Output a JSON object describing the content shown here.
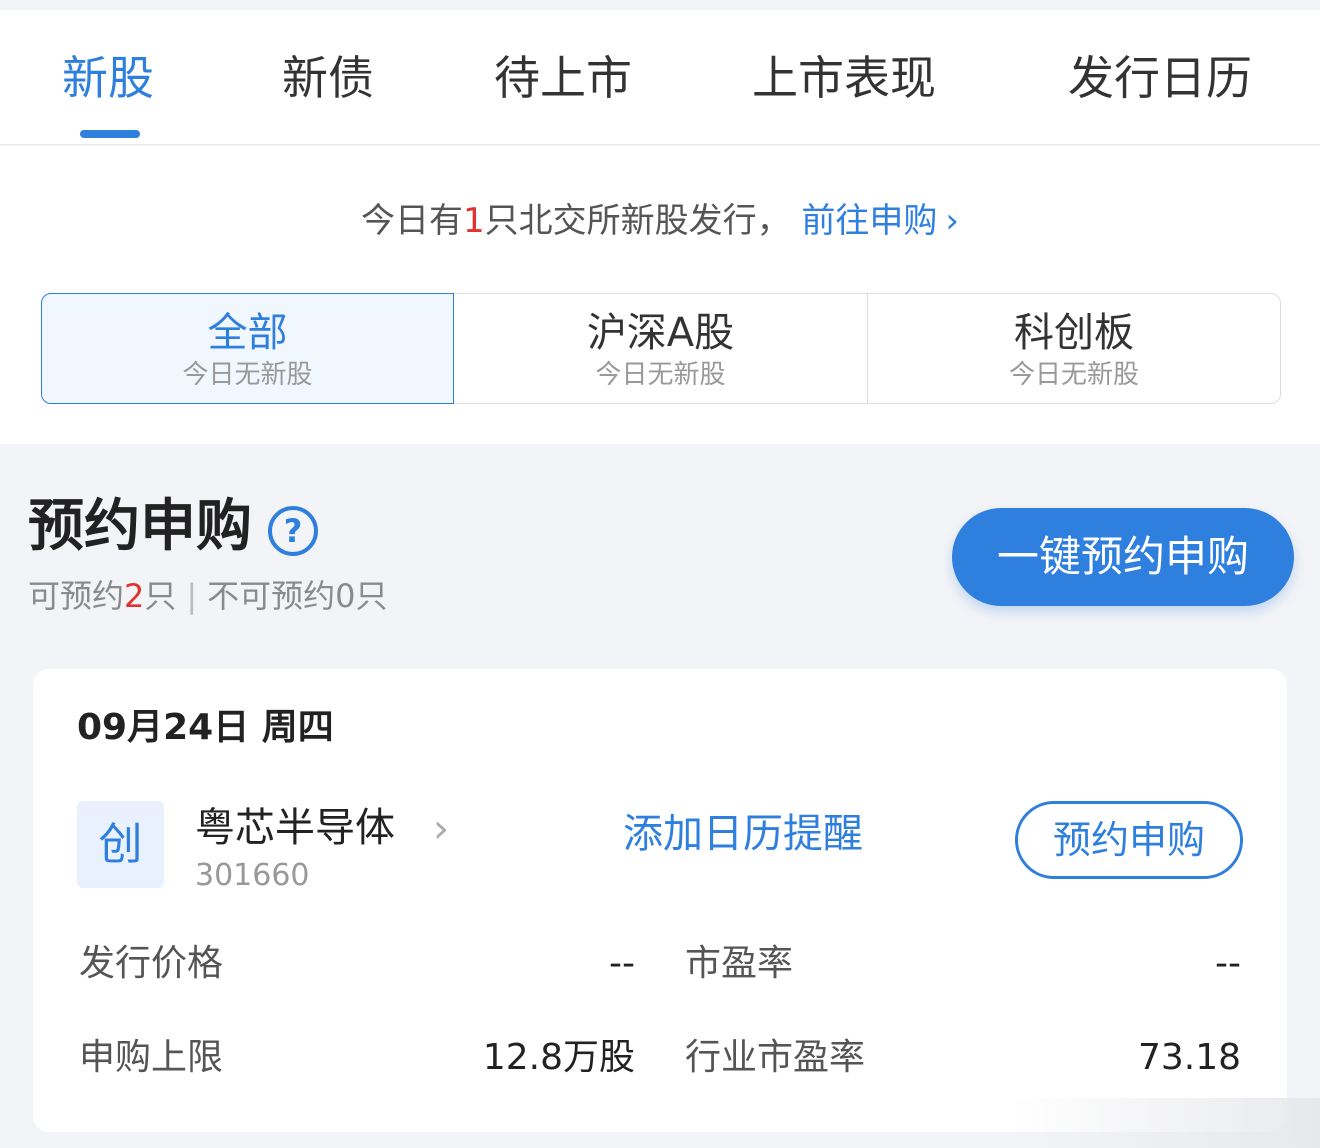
{
  "tabs": [
    {
      "label": "新股",
      "active": true
    },
    {
      "label": "新债"
    },
    {
      "label": "待上市"
    },
    {
      "label": "上市表现"
    },
    {
      "label": "发行日历"
    }
  ],
  "notice": {
    "prefix": "今日有",
    "count": "1",
    "suffix": "只北交所新股发行，",
    "link": "前往申购"
  },
  "segments": [
    {
      "title": "全部",
      "subtitle": "今日无新股"
    },
    {
      "title": "沪深A股",
      "subtitle": "今日无新股"
    },
    {
      "title": "科创板",
      "subtitle": "今日无新股"
    }
  ],
  "reserve_section": {
    "title": "预约申购",
    "available_prefix": "可预约",
    "available_count": "2",
    "available_suffix": "只",
    "separator": "|",
    "unavailable": "不可预约0只",
    "one_key_button": "一键预约申购"
  },
  "card": {
    "date": "09月24日 周四",
    "badge": "创",
    "stock_name": "粤芯半导体",
    "stock_code": "301660",
    "calendar_link": "添加日历提醒",
    "reserve_button": "预约申购",
    "fields": {
      "issue_price_label": "发行价格",
      "issue_price_value": "--",
      "pe_label": "市盈率",
      "pe_value": "--",
      "limit_label": "申购上限",
      "limit_value": "12.8万股",
      "industry_pe_label": "行业市盈率",
      "industry_pe_value": "73.18"
    }
  },
  "colors": {
    "accent": "#2f7fdf",
    "red": "#e0332f"
  }
}
